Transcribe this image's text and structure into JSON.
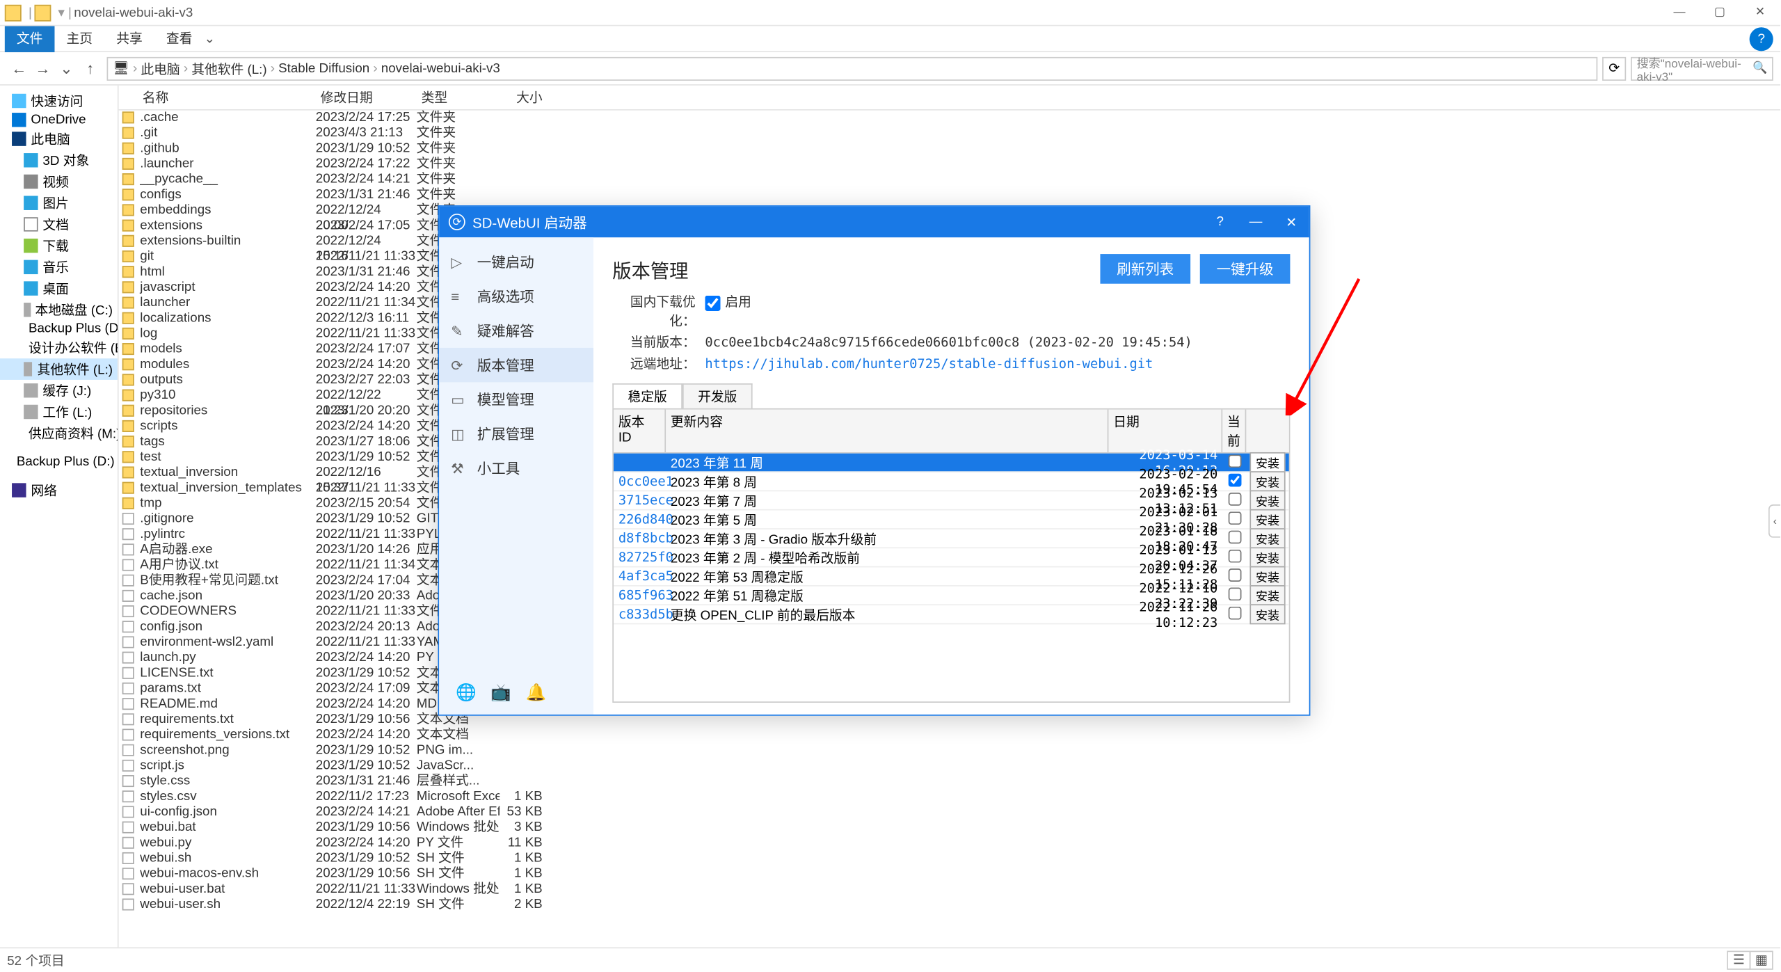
{
  "window": {
    "title": "novelai-webui-aki-v3",
    "ribbon": [
      "文件",
      "主页",
      "共享",
      "查看"
    ],
    "breadcrumbs": [
      "此电脑",
      "其他软件 (L:)",
      "Stable Diffusion",
      "novelai-webui-aki-v3"
    ],
    "search_placeholder": "搜索\"novelai-webui-aki-v3\"",
    "columns": [
      "名称",
      "修改日期",
      "类型",
      "大小"
    ],
    "status": "52 个项目"
  },
  "sidebar": [
    {
      "ico": "ico-star",
      "label": "快速访问"
    },
    {
      "ico": "ico-cloud",
      "label": "OneDrive"
    },
    {
      "ico": "ico-pc",
      "label": "此电脑"
    },
    {
      "ico": "ico-3d",
      "label": "3D 对象",
      "indent": true
    },
    {
      "ico": "ico-vid",
      "label": "视频",
      "indent": true
    },
    {
      "ico": "ico-pic",
      "label": "图片",
      "indent": true
    },
    {
      "ico": "ico-doc",
      "label": "文档",
      "indent": true
    },
    {
      "ico": "ico-dl",
      "label": "下载",
      "indent": true
    },
    {
      "ico": "ico-mus",
      "label": "音乐",
      "indent": true
    },
    {
      "ico": "ico-desk",
      "label": "桌面",
      "indent": true
    },
    {
      "ico": "ico-disk",
      "label": "本地磁盘 (C:)",
      "indent": true
    },
    {
      "ico": "ico-disk",
      "label": "Backup Plus (D:)",
      "indent": true
    },
    {
      "ico": "ico-disk",
      "label": "设计办公软件 (E:)",
      "indent": true
    },
    {
      "ico": "ico-disk",
      "label": "其他软件 (L:)",
      "indent": true,
      "sel": true
    },
    {
      "ico": "ico-disk",
      "label": "缓存 (J:)",
      "indent": true
    },
    {
      "ico": "ico-disk",
      "label": "工作 (L:)",
      "indent": true
    },
    {
      "ico": "ico-disk",
      "label": "供应商资料 (M:)",
      "indent": true
    },
    {
      "spacer": true
    },
    {
      "ico": "ico-disk",
      "label": "Backup Plus (D:)"
    },
    {
      "spacer": true
    },
    {
      "ico": "ico-net",
      "label": "网络"
    }
  ],
  "files": [
    {
      "n": ".cache",
      "d": "2023/2/24 17:25",
      "t": "文件夹",
      "f": true
    },
    {
      "n": ".git",
      "d": "2023/4/3 21:13",
      "t": "文件夹",
      "f": true
    },
    {
      "n": ".github",
      "d": "2023/1/29 10:52",
      "t": "文件夹",
      "f": true
    },
    {
      "n": ".launcher",
      "d": "2023/2/24 17:22",
      "t": "文件夹",
      "f": true
    },
    {
      "n": "__pycache__",
      "d": "2023/2/24 14:21",
      "t": "文件夹",
      "f": true
    },
    {
      "n": "configs",
      "d": "2023/1/31 21:46",
      "t": "文件夹",
      "f": true
    },
    {
      "n": "embeddings",
      "d": "2022/12/24 20:00",
      "t": "文件夹",
      "f": true
    },
    {
      "n": "extensions",
      "d": "2023/2/24 17:05",
      "t": "文件夹",
      "f": true
    },
    {
      "n": "extensions-builtin",
      "d": "2022/12/24 15:16",
      "t": "文件夹",
      "f": true
    },
    {
      "n": "git",
      "d": "2022/11/21 11:33",
      "t": "文件夹",
      "f": true
    },
    {
      "n": "html",
      "d": "2023/1/31 21:46",
      "t": "文件夹",
      "f": true
    },
    {
      "n": "javascript",
      "d": "2023/2/24 14:20",
      "t": "文件夹",
      "f": true
    },
    {
      "n": "launcher",
      "d": "2022/11/21 11:34",
      "t": "文件夹",
      "f": true
    },
    {
      "n": "localizations",
      "d": "2022/12/3 16:11",
      "t": "文件夹",
      "f": true
    },
    {
      "n": "log",
      "d": "2022/11/21 11:33",
      "t": "文件夹",
      "f": true
    },
    {
      "n": "models",
      "d": "2023/2/24 17:07",
      "t": "文件夹",
      "f": true
    },
    {
      "n": "modules",
      "d": "2023/2/24 14:20",
      "t": "文件夹",
      "f": true
    },
    {
      "n": "outputs",
      "d": "2023/2/27 22:03",
      "t": "文件夹",
      "f": true
    },
    {
      "n": "py310",
      "d": "2022/12/22 21:23",
      "t": "文件夹",
      "f": true
    },
    {
      "n": "repositories",
      "d": "2023/1/20 20:20",
      "t": "文件夹",
      "f": true
    },
    {
      "n": "scripts",
      "d": "2023/2/24 14:20",
      "t": "文件夹",
      "f": true
    },
    {
      "n": "tags",
      "d": "2023/1/27 18:06",
      "t": "文件夹",
      "f": true
    },
    {
      "n": "test",
      "d": "2023/1/29 10:52",
      "t": "文件夹",
      "f": true
    },
    {
      "n": "textual_inversion",
      "d": "2022/12/16 15:37",
      "t": "文件夹",
      "f": true
    },
    {
      "n": "textual_inversion_templates",
      "d": "2022/11/21 11:33",
      "t": "文件夹",
      "f": true
    },
    {
      "n": "tmp",
      "d": "2023/2/15 20:54",
      "t": "文件夹",
      "f": true
    },
    {
      "n": ".gitignore",
      "d": "2023/1/29 10:52",
      "t": "GITIGN..."
    },
    {
      "n": ".pylintrc",
      "d": "2022/11/21 11:33",
      "t": "PYLINTR..."
    },
    {
      "n": "A启动器.exe",
      "d": "2023/1/20 14:26",
      "t": "应用程序"
    },
    {
      "n": "A用户协议.txt",
      "d": "2022/11/21 11:34",
      "t": "文本文档"
    },
    {
      "n": "B使用教程+常见问题.txt",
      "d": "2023/2/24 17:04",
      "t": "文本文档"
    },
    {
      "n": "cache.json",
      "d": "2023/1/20 20:33",
      "t": "Adobe ..."
    },
    {
      "n": "CODEOWNERS",
      "d": "2022/11/21 11:33",
      "t": "文件"
    },
    {
      "n": "config.json",
      "d": "2023/2/24 20:13",
      "t": "Adobe ..."
    },
    {
      "n": "environment-wsl2.yaml",
      "d": "2022/11/21 11:33",
      "t": "YAML 文..."
    },
    {
      "n": "launch.py",
      "d": "2023/2/24 14:20",
      "t": "PY 文件"
    },
    {
      "n": "LICENSE.txt",
      "d": "2023/1/29 10:52",
      "t": "文本文档"
    },
    {
      "n": "params.txt",
      "d": "2023/2/24 17:09",
      "t": "文本文档"
    },
    {
      "n": "README.md",
      "d": "2023/2/24 14:20",
      "t": "MD 文件"
    },
    {
      "n": "requirements.txt",
      "d": "2023/1/29 10:56",
      "t": "文本文档"
    },
    {
      "n": "requirements_versions.txt",
      "d": "2023/2/24 14:20",
      "t": "文本文档"
    },
    {
      "n": "screenshot.png",
      "d": "2023/1/29 10:52",
      "t": "PNG im..."
    },
    {
      "n": "script.js",
      "d": "2023/1/29 10:52",
      "t": "JavaScr..."
    },
    {
      "n": "style.css",
      "d": "2023/1/31 21:46",
      "t": "层叠样式..."
    },
    {
      "n": "styles.csv",
      "d": "2022/11/2 17:23",
      "t": "Microsoft Excel ...",
      "s": "1 KB"
    },
    {
      "n": "ui-config.json",
      "d": "2023/2/24 14:21",
      "t": "Adobe After Effe...",
      "s": "53 KB"
    },
    {
      "n": "webui.bat",
      "d": "2023/1/29 10:56",
      "t": "Windows 批处理...",
      "s": "3 KB"
    },
    {
      "n": "webui.py",
      "d": "2023/2/24 14:20",
      "t": "PY 文件",
      "s": "11 KB"
    },
    {
      "n": "webui.sh",
      "d": "2023/1/29 10:52",
      "t": "SH 文件",
      "s": "1 KB"
    },
    {
      "n": "webui-macos-env.sh",
      "d": "2023/1/29 10:56",
      "t": "SH 文件",
      "s": "1 KB"
    },
    {
      "n": "webui-user.bat",
      "d": "2022/11/21 11:33",
      "t": "Windows 批处理...",
      "s": "1 KB"
    },
    {
      "n": "webui-user.sh",
      "d": "2022/12/4 22:19",
      "t": "SH 文件",
      "s": "2 KB"
    }
  ],
  "modal": {
    "title": "SD-WebUI 启动器",
    "side": [
      {
        "ico": "▷",
        "label": "一键启动"
      },
      {
        "ico": "≡",
        "label": "高级选项"
      },
      {
        "ico": "✎",
        "label": "疑难解答"
      },
      {
        "ico": "⟳",
        "label": "版本管理",
        "active": true
      },
      {
        "ico": "▭",
        "label": "模型管理"
      },
      {
        "ico": "◫",
        "label": "扩展管理"
      },
      {
        "ico": "⚒",
        "label": "小工具"
      }
    ],
    "foot_icons": [
      "🌐",
      "📺",
      "🔔"
    ],
    "heading": "版本管理",
    "btn_refresh": "刷新列表",
    "btn_upgrade": "一键升级",
    "info": {
      "opt_label": "国内下载优化：",
      "opt_text": "启用",
      "ver_label": "当前版本：",
      "ver_text": "0cc0ee1bcb4c24a8c9715f66cede06601bfc00c8 (2023-02-20 19:45:54)",
      "url_label": "远端地址：",
      "url_text": "https://jihulab.com/hunter0725/stable-diffusion-webui.git"
    },
    "tabs": [
      "稳定版",
      "开发版"
    ],
    "thead": [
      "版本 ID",
      "更新内容",
      "日期",
      "当前",
      ""
    ],
    "rows": [
      {
        "id": "",
        "desc": "2023 年第 11 周",
        "date": "2023-03-14 16:28:13",
        "cur": false,
        "sel": true,
        "btn": "安装"
      },
      {
        "id": "0cc0ee1",
        "desc": "2023 年第 8 周",
        "date": "2023-02-20 19:45:54",
        "cur": true,
        "btn": "安装"
      },
      {
        "id": "3715ece",
        "desc": "2023 年第 7 周",
        "date": "2023-02-13 13:12:51",
        "btn": "安装"
      },
      {
        "id": "226d840",
        "desc": "2023 年第 5 周",
        "date": "2023-02-01 21:30:28",
        "btn": "安装"
      },
      {
        "id": "d8f8bcb",
        "desc": "2023 年第 3 周 - Gradio 版本升级前",
        "date": "2023-01-18 18:20:47",
        "btn": "安装"
      },
      {
        "id": "82725f0",
        "desc": "2023 年第 2 周 - 模型哈希改版前",
        "date": "2023-01-13 20:04:37",
        "btn": "安装"
      },
      {
        "id": "4af3ca5",
        "desc": "2022 年第 53 周稳定版",
        "date": "2022-12-26 15:11:28",
        "btn": "安装"
      },
      {
        "id": "685f963",
        "desc": "2022 年第 51 周稳定版",
        "date": "2022-12-10 23:22:39",
        "btn": "安装"
      },
      {
        "id": "c833d5b",
        "desc": "更换 OPEN_CLIP 前的最后版本",
        "date": "2022-11-26 10:12:23",
        "btn": "安装"
      }
    ]
  }
}
